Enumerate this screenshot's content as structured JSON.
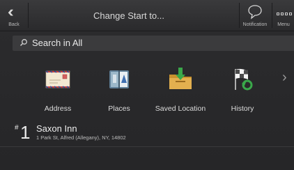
{
  "header": {
    "back_label": "Back",
    "title": "Change Start to...",
    "notification_label": "Notification",
    "menu_label": "Menu"
  },
  "search": {
    "text": "Search in All"
  },
  "categories": [
    {
      "label": "Address",
      "icon": "envelope-icon"
    },
    {
      "label": "Places",
      "icon": "map-book-icon"
    },
    {
      "label": "Saved Location",
      "icon": "folder-download-icon"
    },
    {
      "label": "History",
      "icon": "checkered-flag-history-icon"
    }
  ],
  "results": [
    {
      "rank_hash": "#",
      "rank": "1",
      "name": "Saxon Inn",
      "address": "1 Park St, Alfred (Allegany), NY, 14802"
    }
  ],
  "colors": {
    "background": "#2b2b2d",
    "search_bg": "#3b3b3d",
    "text": "#e8e8e8"
  }
}
